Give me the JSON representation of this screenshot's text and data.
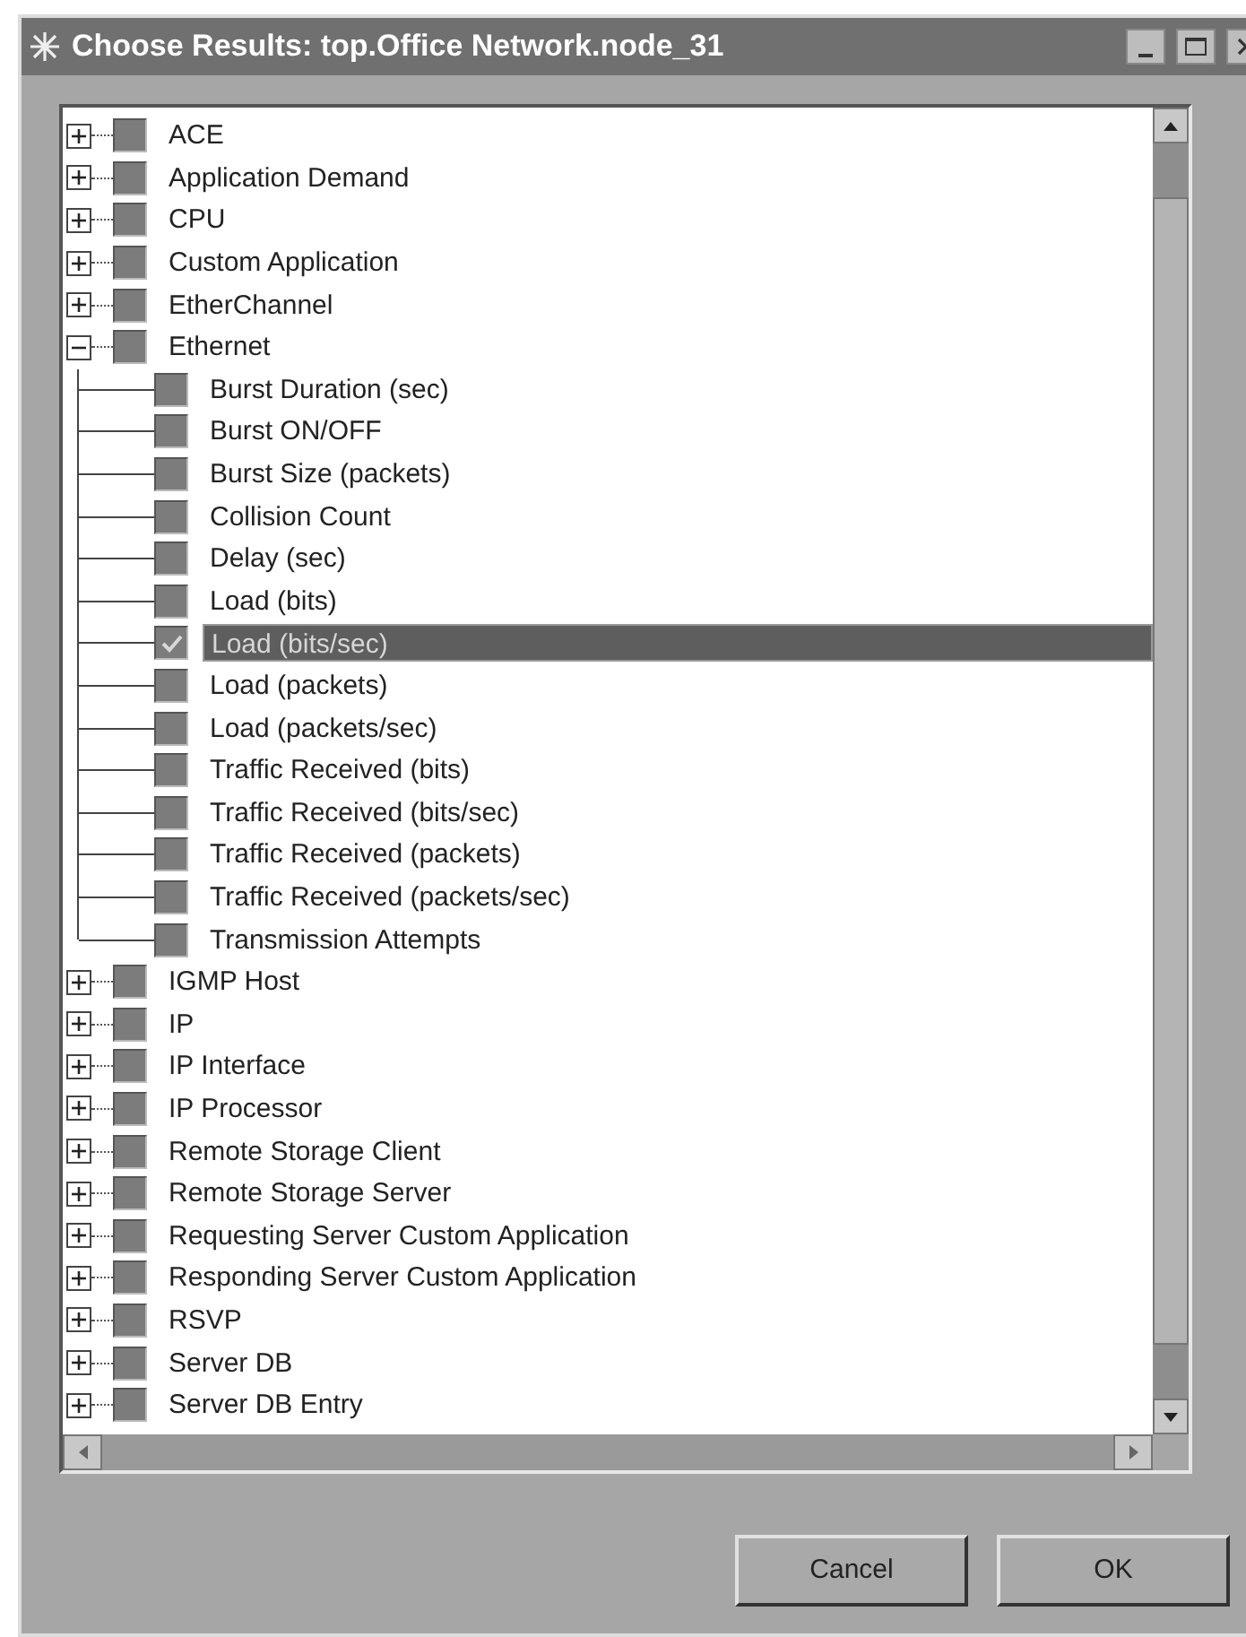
{
  "window": {
    "title": "Choose Results: top.Office Network.node_31"
  },
  "tree": {
    "items": [
      {
        "label": "ACE",
        "expanded": false,
        "checked": false,
        "selected": false
      },
      {
        "label": "Application Demand",
        "expanded": false,
        "checked": false,
        "selected": false
      },
      {
        "label": "CPU",
        "expanded": false,
        "checked": false,
        "selected": false
      },
      {
        "label": "Custom Application",
        "expanded": false,
        "checked": false,
        "selected": false
      },
      {
        "label": "EtherChannel",
        "expanded": false,
        "checked": false,
        "selected": false
      },
      {
        "label": "Ethernet",
        "expanded": true,
        "checked": false,
        "selected": false,
        "children": [
          {
            "label": "Burst Duration (sec)",
            "checked": false,
            "selected": false
          },
          {
            "label": "Burst ON/OFF",
            "checked": false,
            "selected": false
          },
          {
            "label": "Burst Size (packets)",
            "checked": false,
            "selected": false
          },
          {
            "label": "Collision Count",
            "checked": false,
            "selected": false
          },
          {
            "label": "Delay (sec)",
            "checked": false,
            "selected": false
          },
          {
            "label": "Load (bits)",
            "checked": false,
            "selected": false
          },
          {
            "label": "Load (bits/sec)",
            "checked": true,
            "selected": true
          },
          {
            "label": "Load (packets)",
            "checked": false,
            "selected": false
          },
          {
            "label": "Load (packets/sec)",
            "checked": false,
            "selected": false
          },
          {
            "label": "Traffic Received (bits)",
            "checked": false,
            "selected": false
          },
          {
            "label": "Traffic Received (bits/sec)",
            "checked": false,
            "selected": false
          },
          {
            "label": "Traffic Received (packets)",
            "checked": false,
            "selected": false
          },
          {
            "label": "Traffic Received (packets/sec)",
            "checked": false,
            "selected": false
          },
          {
            "label": "Transmission Attempts",
            "checked": false,
            "selected": false
          }
        ]
      },
      {
        "label": "IGMP Host",
        "expanded": false,
        "checked": false,
        "selected": false
      },
      {
        "label": "IP",
        "expanded": false,
        "checked": false,
        "selected": false
      },
      {
        "label": "IP Interface",
        "expanded": false,
        "checked": false,
        "selected": false
      },
      {
        "label": "IP Processor",
        "expanded": false,
        "checked": false,
        "selected": false
      },
      {
        "label": "Remote Storage Client",
        "expanded": false,
        "checked": false,
        "selected": false
      },
      {
        "label": "Remote Storage Server",
        "expanded": false,
        "checked": false,
        "selected": false
      },
      {
        "label": "Requesting Server Custom Application",
        "expanded": false,
        "checked": false,
        "selected": false
      },
      {
        "label": "Responding Server Custom Application",
        "expanded": false,
        "checked": false,
        "selected": false
      },
      {
        "label": "RSVP",
        "expanded": false,
        "checked": false,
        "selected": false
      },
      {
        "label": "Server DB",
        "expanded": false,
        "checked": false,
        "selected": false
      },
      {
        "label": "Server DB Entry",
        "expanded": false,
        "checked": false,
        "selected": false
      }
    ]
  },
  "buttons": [
    {
      "label": "Cancel"
    },
    {
      "label": "OK"
    }
  ]
}
